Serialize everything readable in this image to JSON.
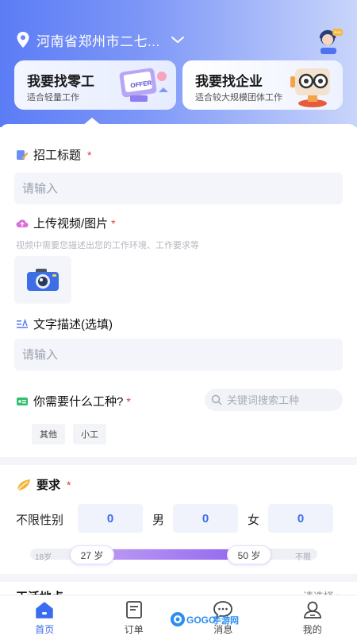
{
  "header": {
    "location": "河南省郑州市二七...",
    "icons": {
      "location": "location-pin-icon",
      "expand": "chevron-down-icon",
      "service": "customer-service-icon"
    }
  },
  "entry_cards": [
    {
      "title": "我要找零工",
      "subtitle": "适合轻量工作",
      "art_text": "OFFER"
    },
    {
      "title": "我要找企业",
      "subtitle": "适合较大规模团体工作"
    }
  ],
  "form": {
    "title_field": {
      "label": "招工标题",
      "required": "*",
      "placeholder": "请输入"
    },
    "upload": {
      "label": "上传视频/图片",
      "required": "*",
      "hint": "视频中需要您描述出您的工作环境、工作要求等"
    },
    "description": {
      "label": "文字描述(选填)",
      "placeholder": "请输入"
    },
    "work_type": {
      "label": "你需要什么工种?",
      "required": "*",
      "search_placeholder": "关键词搜索工种",
      "chips": [
        "其他",
        "小工"
      ]
    },
    "requirements": {
      "label": "要求",
      "required": "*",
      "gender_any_label": "不限性别",
      "gender_any_count": "0",
      "male_label": "男",
      "male_count": "0",
      "female_label": "女",
      "female_count": "0",
      "age": {
        "min_label": "18岁",
        "low": "27 岁",
        "high": "50 岁",
        "max_label": "不限"
      }
    },
    "location_peek": {
      "label": "干活地点:",
      "action": "请选择 >"
    }
  },
  "tabbar": {
    "tabs": [
      {
        "label": "首页",
        "icon": "home-icon",
        "active": true
      },
      {
        "label": "订单",
        "icon": "order-list-icon",
        "active": false
      },
      {
        "label": "消息",
        "icon": "message-icon",
        "active": false
      },
      {
        "label": "我的",
        "icon": "profile-icon",
        "active": false
      }
    ]
  },
  "watermark": {
    "text_a": "GOGO",
    "text_b": "手游网"
  },
  "colors": {
    "primary": "#3a6cf2",
    "required": "#e23b3b",
    "range_fill": "#8f62ee"
  }
}
